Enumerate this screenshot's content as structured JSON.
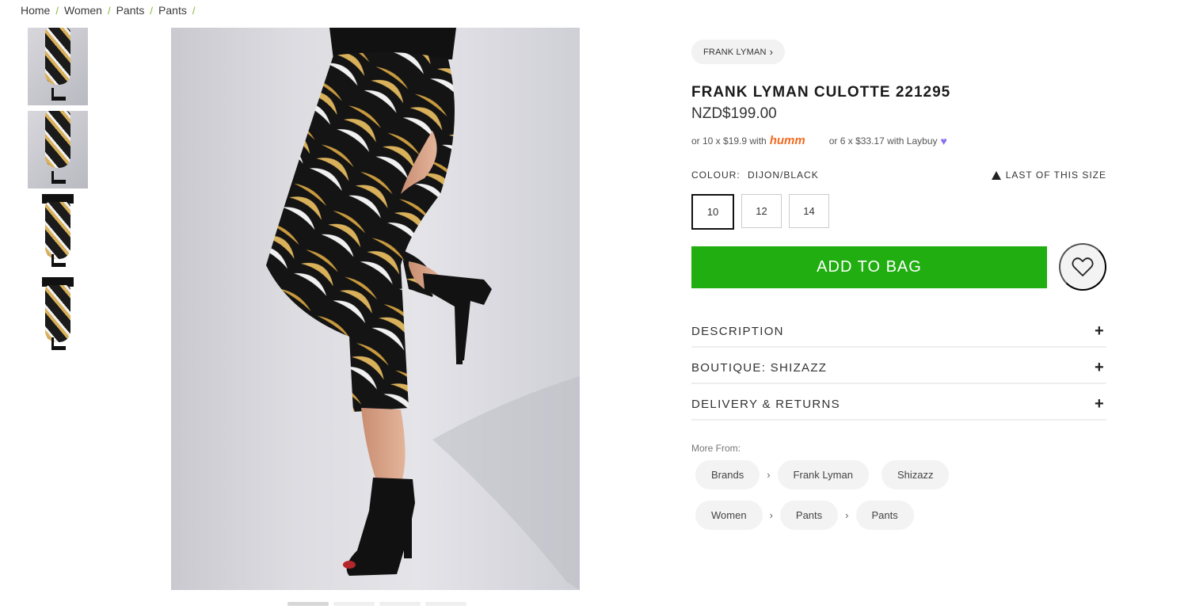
{
  "breadcrumb": [
    "Home",
    "Women",
    "Pants",
    "Pants"
  ],
  "breadcrumb_sep": "/",
  "product": {
    "brand_pill": "FRANK LYMAN",
    "title": "FRANK LYMAN CULOTTE 221295",
    "price": "NZD$199.00",
    "humm_text": "or 10 x $19.9 with",
    "humm_logo": "humm",
    "laybuy_text": "or 6 x $33.17 with Laybuy",
    "colour_label": "COLOUR:",
    "colour_value": "DIJON/BLACK",
    "stock_notice": "LAST OF THIS SIZE",
    "sizes": [
      "10",
      "12",
      "14"
    ],
    "selected_size": "10",
    "add_to_bag": "ADD TO BAG"
  },
  "accordion": [
    "DESCRIPTION",
    "BOUTIQUE: SHIZAZZ",
    "DELIVERY & RETURNS"
  ],
  "more_from": {
    "label": "More From:",
    "row1": [
      "Brands",
      "Frank Lyman",
      "Shizazz"
    ],
    "row2": [
      "Women",
      "Pants",
      "Pants"
    ]
  },
  "gallery": {
    "thumbnail_count": 4,
    "active_slide": 1,
    "slide_count": 4
  },
  "colors": {
    "add_to_bag": "#21ae11",
    "humm": "#f26a21",
    "laybuy": "#8b6ff2",
    "breadcrumb_sep": "#8cb43c"
  }
}
